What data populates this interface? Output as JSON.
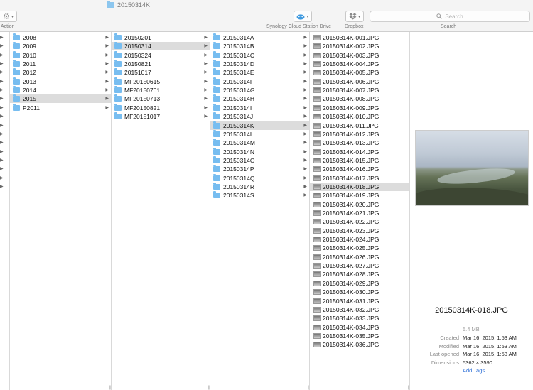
{
  "window": {
    "title": "20150314K"
  },
  "toolbar": {
    "action_label": "Action",
    "synology_label": "Synology Cloud Station Drive",
    "dropbox_label": "Dropbox",
    "search_label": "Search",
    "search_placeholder": "Search"
  },
  "columns": {
    "years": [
      "2008",
      "2009",
      "2010",
      "2011",
      "2012",
      "2013",
      "2014",
      "2015",
      "P2011"
    ],
    "years_selected": "2015",
    "dates": [
      "20150201",
      "20150314",
      "20150324",
      "20150821",
      "20151017",
      "MF20150615",
      "MF20150701",
      "MF20150713",
      "MF20150821",
      "MF20151017"
    ],
    "dates_selected": "20150314",
    "rolls": [
      "20150314A",
      "20150314B",
      "20150314C",
      "20150314D",
      "20150314E",
      "20150314F",
      "20150314G",
      "20150314H",
      "20150314I",
      "20150314J",
      "20150314K",
      "20150314L",
      "20150314M",
      "20150314N",
      "20150314O",
      "20150314P",
      "20150314Q",
      "20150314R",
      "20150314S"
    ],
    "rolls_selected": "20150314K",
    "files": [
      "20150314K-001.JPG",
      "20150314K-002.JPG",
      "20150314K-003.JPG",
      "20150314K-004.JPG",
      "20150314K-005.JPG",
      "20150314K-006.JPG",
      "20150314K-007.JPG",
      "20150314K-008.JPG",
      "20150314K-009.JPG",
      "20150314K-010.JPG",
      "20150314K-011.JPG",
      "20150314K-012.JPG",
      "20150314K-013.JPG",
      "20150314K-014.JPG",
      "20150314K-015.JPG",
      "20150314K-016.JPG",
      "20150314K-017.JPG",
      "20150314K-018.JPG",
      "20150314K-019.JPG",
      "20150314K-020.JPG",
      "20150314K-021.JPG",
      "20150314K-022.JPG",
      "20150314K-023.JPG",
      "20150314K-024.JPG",
      "20150314K-025.JPG",
      "20150314K-026.JPG",
      "20150314K-027.JPG",
      "20150314K-028.JPG",
      "20150314K-029.JPG",
      "20150314K-030.JPG",
      "20150314K-031.JPG",
      "20150314K-032.JPG",
      "20150314K-033.JPG",
      "20150314K-034.JPG",
      "20150314K-035.JPG",
      "20150314K-036.JPG"
    ],
    "files_selected": "20150314K-018.JPG"
  },
  "preview": {
    "name": "20150314K-018.JPG",
    "size": "5.4 MB",
    "created_label": "Created",
    "created_value": "Mar 16, 2015, 1:53 AM",
    "modified_label": "Modified",
    "modified_value": "Mar 16, 2015, 1:53 AM",
    "last_opened_label": "Last opened",
    "last_opened_value": "Mar 16, 2015, 1:53 AM",
    "dimensions_label": "Dimensions",
    "dimensions_value": "5362 × 3590",
    "add_tags": "Add Tags…"
  },
  "icons": {
    "action": "gear-icon",
    "synology": "cloud-icon",
    "dropbox": "dropbox-icon",
    "search": "magnifier-icon",
    "folder": "folder-icon",
    "thumbnail": "image-thumbnail-icon"
  },
  "colors": {
    "folder": "#77bdf0",
    "selection": "#dcdcdc",
    "link": "#2a6dd6",
    "synology": "#3f9ae0"
  }
}
